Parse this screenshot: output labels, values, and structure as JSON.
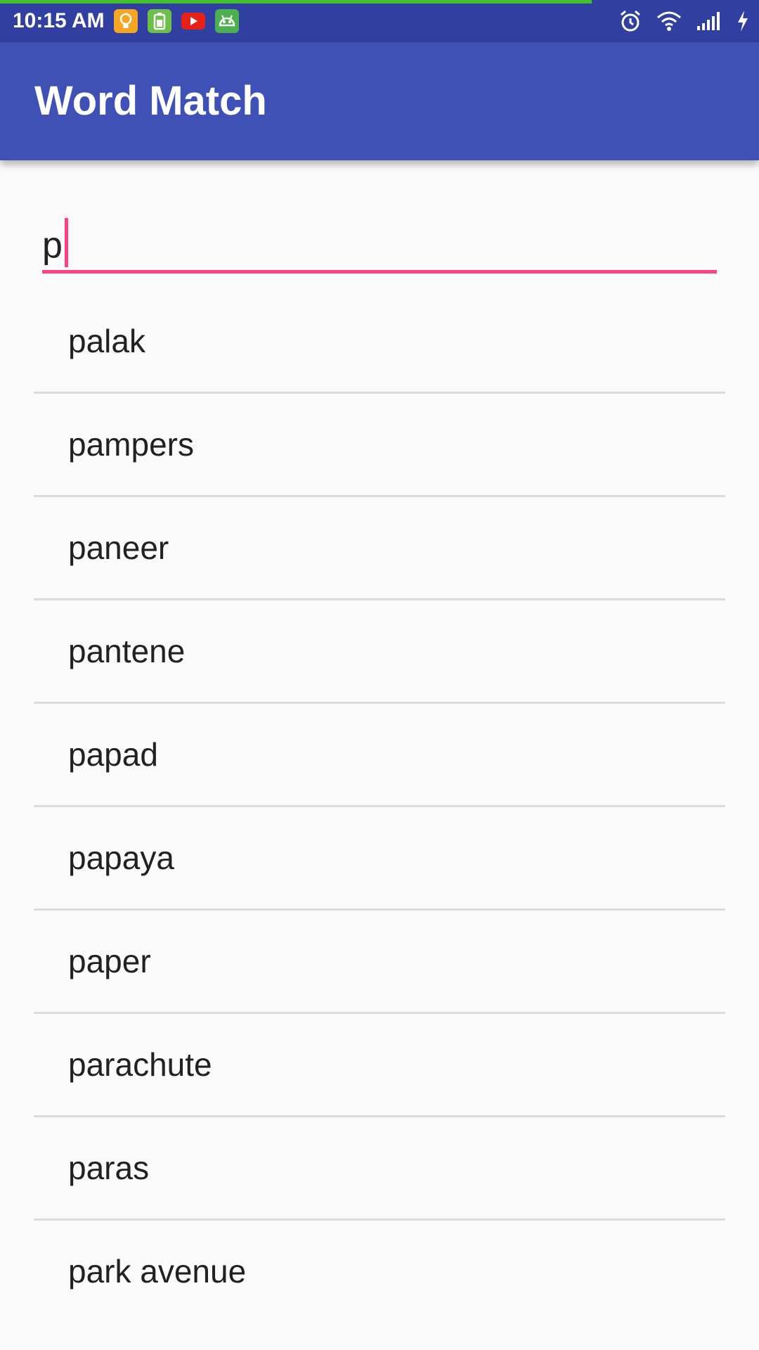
{
  "status_bar": {
    "time": "10:15 AM",
    "progress": 0.78,
    "notification_icons": [
      {
        "name": "lightbulb-app-icon",
        "color": "#f5a623"
      },
      {
        "name": "battery-app-icon",
        "color": "#6cc04a"
      },
      {
        "name": "youtube-icon",
        "color": "#e62117"
      },
      {
        "name": "android-app-icon",
        "color": "#4caf50"
      }
    ],
    "system_icons": [
      "alarm-icon",
      "wifi-icon",
      "signal-icon",
      "charging-icon"
    ]
  },
  "app_bar": {
    "title": "Word Match"
  },
  "search": {
    "value": "p",
    "accent_color": "#ff4081"
  },
  "suggestions": [
    "palak",
    "pampers",
    "paneer",
    "pantene",
    "papad",
    "papaya",
    "paper",
    "parachute",
    "paras",
    "park avenue"
  ],
  "colors": {
    "status_bar": "#3140a0",
    "app_bar": "#3f51b5",
    "background": "#fafafa",
    "divider": "#dcdcdc",
    "text": "#212121"
  }
}
